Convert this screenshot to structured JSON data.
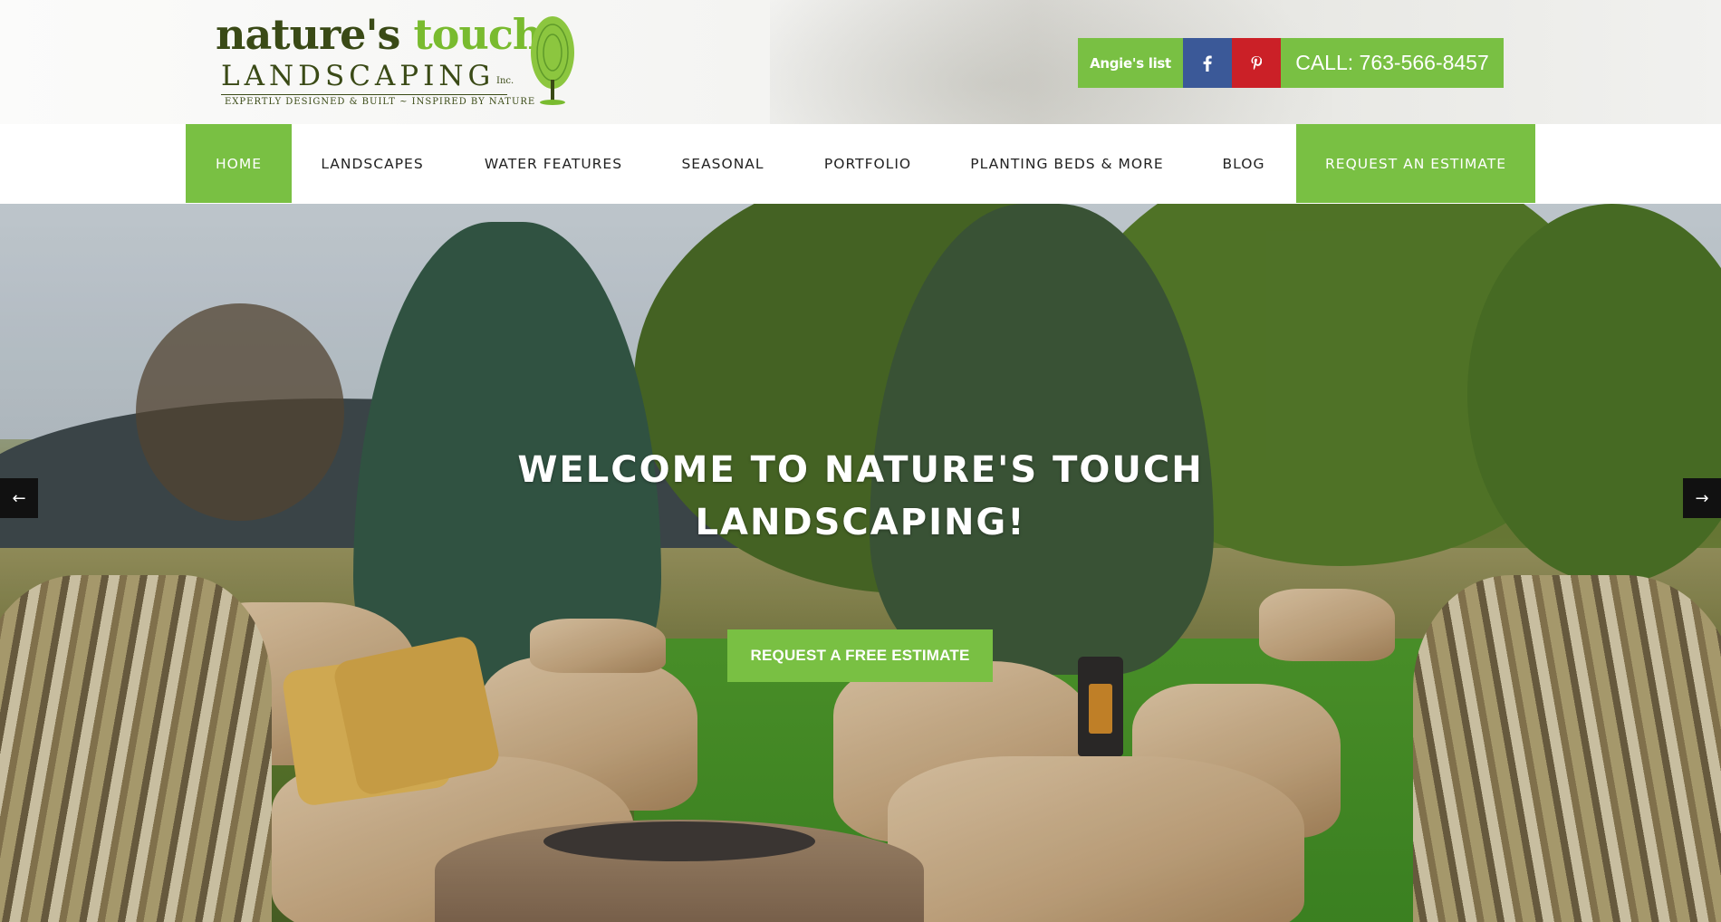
{
  "logo": {
    "word1": "nature's",
    "word2": "touch",
    "line2": "LANDSCAPING",
    "inc": "Inc.",
    "tagline": "EXPERTLY DESIGNED & BUILT ~ INSPIRED BY NATURE"
  },
  "header": {
    "angies_label": "Angie's list",
    "facebook_icon": "facebook-icon",
    "pinterest_icon": "pinterest-icon",
    "call_label": "CALL: 763-566-8457"
  },
  "nav": {
    "items": [
      {
        "label": "HOME",
        "active": true
      },
      {
        "label": "LANDSCAPES"
      },
      {
        "label": "WATER FEATURES"
      },
      {
        "label": "SEASONAL"
      },
      {
        "label": "PORTFOLIO"
      },
      {
        "label": "PLANTING BEDS & MORE"
      },
      {
        "label": "BLOG"
      },
      {
        "label": "REQUEST AN ESTIMATE"
      }
    ]
  },
  "hero": {
    "title_line1": "WELCOME TO NATURE'S TOUCH",
    "title_line2": "LANDSCAPING!",
    "button_label": "REQUEST A FREE ESTIMATE",
    "prev_arrow": "←",
    "next_arrow": "→"
  },
  "colors": {
    "accent_green": "#79c043",
    "logo_dark_green": "#3a4a16",
    "facebook_blue": "#3b5998",
    "pinterest_red": "#cb2027"
  }
}
